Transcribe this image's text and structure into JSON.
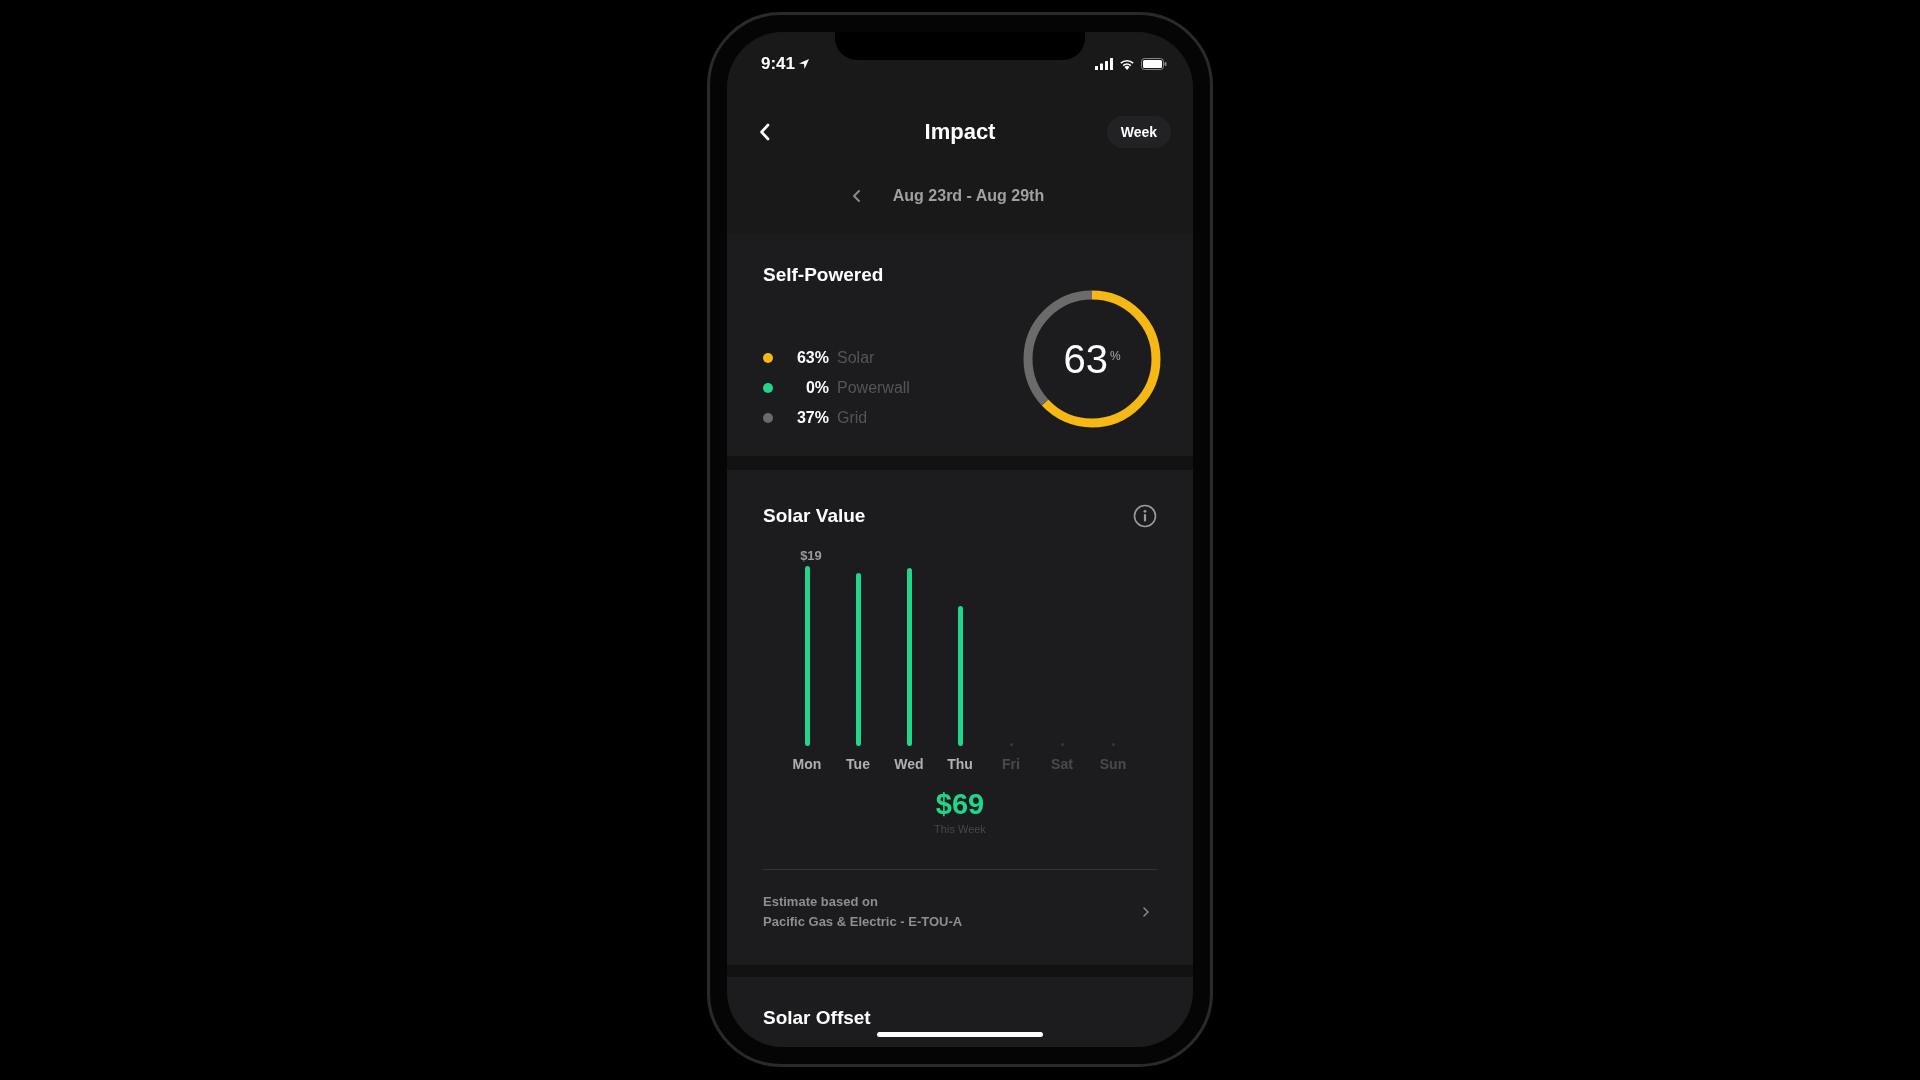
{
  "status_bar": {
    "time": "9:41"
  },
  "header": {
    "title": "Impact",
    "period_button": "Week"
  },
  "date_range": {
    "label": "Aug 23rd - Aug 29th"
  },
  "self_powered": {
    "title": "Self-Powered",
    "donut": {
      "value": "63",
      "unit": "%"
    },
    "breakdown": [
      {
        "percent": "63%",
        "label": "Solar",
        "color": "#f5b814",
        "level": 0.63
      },
      {
        "percent": "0%",
        "label": "Powerwall",
        "color": "#1fd68a",
        "level": 0
      },
      {
        "percent": "37%",
        "label": "Grid",
        "color": "#6b6b6b",
        "level": 0.37
      }
    ]
  },
  "solar_value": {
    "title": "Solar Value",
    "days": [
      {
        "day": "Mon",
        "value_label": "$19",
        "future": false
      },
      {
        "day": "Tue",
        "future": false
      },
      {
        "day": "Wed",
        "future": false
      },
      {
        "day": "Thu",
        "future": false
      },
      {
        "day": "Fri",
        "future": true
      },
      {
        "day": "Sat",
        "future": true
      },
      {
        "day": "Sun",
        "future": true
      }
    ],
    "total": "$69",
    "total_caption": "This Week",
    "estimate": {
      "line_1": "Estimate based on",
      "line_2": "Pacific Gas & Electric - E-TOU-A"
    }
  },
  "solar_offset": {
    "title": "Solar Offset"
  }
}
